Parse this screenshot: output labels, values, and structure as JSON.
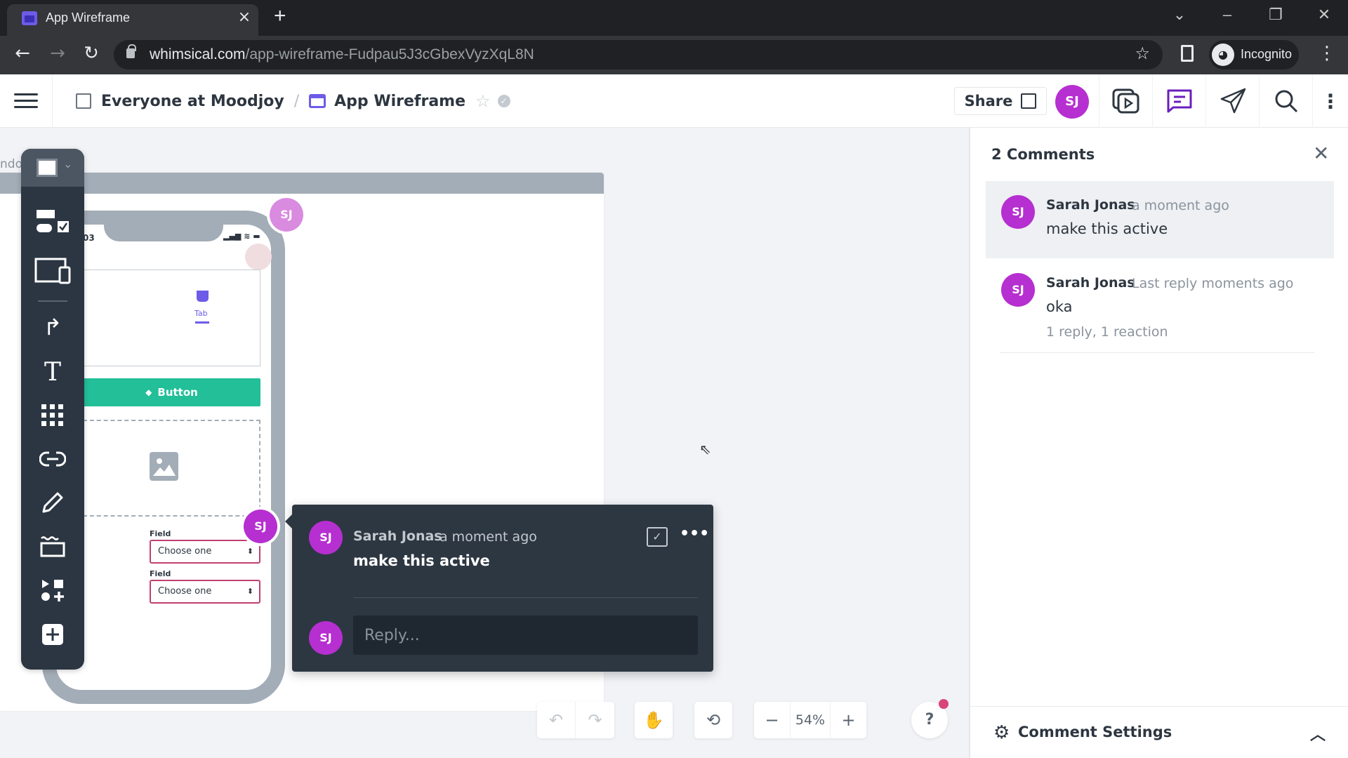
{
  "browser": {
    "tab_title": "App Wireframe",
    "tab_close": "×",
    "new_tab": "+",
    "url_domain": "whimsical.com",
    "url_path": "/app-wireframe-Fudpau5J3cGbexVyzXqL8N",
    "profile_label": "Incognito",
    "window_controls": {
      "list": "⌄",
      "minimize": "–",
      "restore": "❐",
      "close": "✕"
    },
    "nav": {
      "back": "←",
      "forward": "→",
      "reload": "↻"
    }
  },
  "header": {
    "workspace": "Everyone at Moodjoy",
    "separator": "/",
    "board_title": "App Wireframe",
    "share_label": "Share",
    "user_initials": "SJ",
    "accent_color": "#b62fd0",
    "active_icon_color": "#6a1fbd"
  },
  "canvas": {
    "frame_label": "ndo",
    "phone": {
      "status_time": "03",
      "tab_label": "Tab",
      "button_label": "Button",
      "fields": [
        {
          "label": "Field",
          "value": "Choose one"
        },
        {
          "label": "Field",
          "value": "Choose one"
        }
      ]
    },
    "pins": [
      "SJ",
      "SJ"
    ]
  },
  "toolbar": {
    "items": [
      "wireframe-components",
      "device-frames",
      "connector",
      "text",
      "icon-grid",
      "link",
      "pencil",
      "container",
      "shapes",
      "add"
    ]
  },
  "popup": {
    "author": "Sarah Jonas",
    "time": "a moment ago",
    "text": "make this active",
    "avatar": "SJ",
    "reply_placeholder": "Reply...",
    "more": "•••"
  },
  "controls": {
    "undo": "↶",
    "redo": "↷",
    "zoom_out": "−",
    "zoom_level": "54%",
    "zoom_in": "+",
    "help": "?"
  },
  "comments_panel": {
    "title": "2 Comments",
    "close": "✕",
    "comments": [
      {
        "avatar": "SJ",
        "author": "Sarah Jonas",
        "time": "a moment ago",
        "text": "make this active"
      },
      {
        "avatar": "SJ",
        "author": "Sarah Jonas",
        "time": "Last reply moments ago",
        "text": "oka",
        "meta": "1 reply, 1 reaction"
      }
    ],
    "settings_label": "Comment Settings"
  }
}
